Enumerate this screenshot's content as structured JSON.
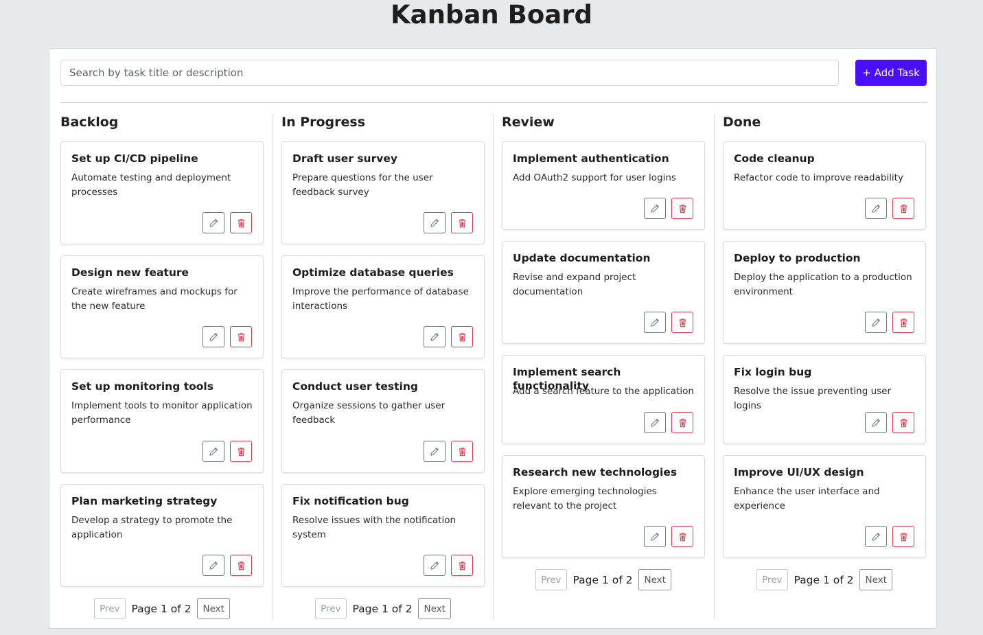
{
  "title": "Kanban Board",
  "search": {
    "placeholder": "Search by task title or description",
    "value": ""
  },
  "add_task_label": "+ Add Task",
  "colors": {
    "accent": "#4a0dff",
    "delete": "#dc3545",
    "edit": "#6c757d"
  },
  "icons": {
    "edit": "pencil-icon",
    "delete": "trash-icon"
  },
  "columns": [
    {
      "title": "Backlog",
      "cards": [
        {
          "title": "Set up CI/CD pipeline",
          "description": "Automate testing and deployment processes"
        },
        {
          "title": "Design new feature",
          "description": "Create wireframes and mockups for the new feature"
        },
        {
          "title": "Set up monitoring tools",
          "description": "Implement tools to monitor application performance"
        },
        {
          "title": "Plan marketing strategy",
          "description": "Develop a strategy to promote the application"
        }
      ],
      "pagination": {
        "prev": "Prev",
        "label": "Page 1 of 2",
        "next": "Next"
      }
    },
    {
      "title": "In Progress",
      "cards": [
        {
          "title": "Draft user survey",
          "description": "Prepare questions for the user feedback survey"
        },
        {
          "title": "Optimize database queries",
          "description": "Improve the performance of database interactions"
        },
        {
          "title": "Conduct user testing",
          "description": "Organize sessions to gather user feedback"
        },
        {
          "title": "Fix notification bug",
          "description": "Resolve issues with the notification system"
        }
      ],
      "pagination": {
        "prev": "Prev",
        "label": "Page 1 of 2",
        "next": "Next"
      }
    },
    {
      "title": "Review",
      "cards": [
        {
          "title": "Implement authentication",
          "description": "Add OAuth2 support for user logins"
        },
        {
          "title": "Update documentation",
          "description": "Revise and expand project documentation"
        },
        {
          "title": "Implement search functionality",
          "description": "Add a search feature to the application"
        },
        {
          "title": "Research new technologies",
          "description": "Explore emerging technologies relevant to the project"
        }
      ],
      "pagination": {
        "prev": "Prev",
        "label": "Page 1 of 2",
        "next": "Next"
      }
    },
    {
      "title": "Done",
      "cards": [
        {
          "title": "Code cleanup",
          "description": "Refactor code to improve readability"
        },
        {
          "title": "Deploy to production",
          "description": "Deploy the application to a production environment"
        },
        {
          "title": "Fix login bug",
          "description": "Resolve the issue preventing user logins"
        },
        {
          "title": "Improve UI/UX design",
          "description": "Enhance the user interface and experience"
        }
      ],
      "pagination": {
        "prev": "Prev",
        "label": "Page 1 of 2",
        "next": "Next"
      }
    }
  ]
}
